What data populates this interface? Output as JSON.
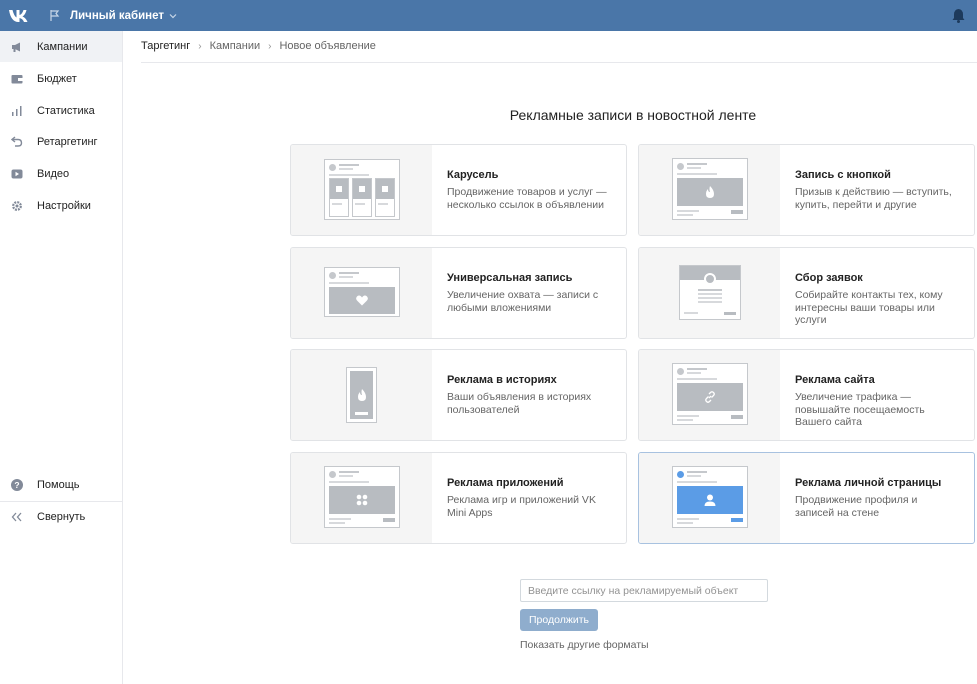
{
  "header": {
    "cabinet_label": "Личный кабинет"
  },
  "sidebar": {
    "items": [
      {
        "label": "Кампании",
        "icon": "megaphone-icon"
      },
      {
        "label": "Бюджет",
        "icon": "wallet-icon"
      },
      {
        "label": "Статистика",
        "icon": "bar-chart-icon"
      },
      {
        "label": "Ретаргетинг",
        "icon": "retarget-arrow-icon"
      },
      {
        "label": "Видео",
        "icon": "video-icon"
      },
      {
        "label": "Настройки",
        "icon": "gear-icon"
      }
    ],
    "bottom": [
      {
        "label": "Помощь",
        "icon": "help-icon"
      },
      {
        "label": "Свернуть",
        "icon": "collapse-icon"
      }
    ]
  },
  "breadcrumb": [
    "Таргетинг",
    "Кампании",
    "Новое объявление"
  ],
  "main": {
    "title": "Рекламные записи в новостной ленте",
    "formats": [
      {
        "title": "Карусель",
        "desc": "Продвижение товаров и услуг — несколько ссылок в объявлении"
      },
      {
        "title": "Запись с кнопкой",
        "desc": "Призыв к действию — вступить, купить, перейти и другие"
      },
      {
        "title": "Универсальная запись",
        "desc": "Увеличение охвата — записи с любыми вложениями"
      },
      {
        "title": "Сбор заявок",
        "desc": "Собирайте контакты тех, кому интересны ваши товары или услуги"
      },
      {
        "title": "Реклама в историях",
        "desc": "Ваши объявления в историях пользователей"
      },
      {
        "title": "Реклама сайта",
        "desc": "Увеличение трафика — повышайте посещаемость Вашего сайта"
      },
      {
        "title": "Реклама приложений",
        "desc": "Реклама игр и приложений VK Mini Apps"
      },
      {
        "title": "Реклама личной страницы",
        "desc": "Продвижение профиля и записей на стене"
      }
    ],
    "url_input": {
      "placeholder": "Введите ссылку на рекламируемый объект",
      "value": ""
    },
    "continue_label": "Продолжить",
    "other_formats_label": "Показать другие форматы"
  },
  "colors": {
    "topbar": "#4a76a8",
    "accent_blue": "#5b9ce6",
    "button": "#8fadcd"
  }
}
